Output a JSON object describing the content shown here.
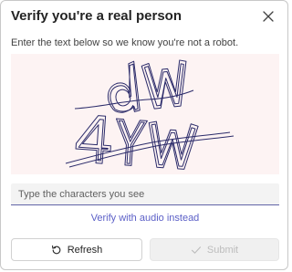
{
  "dialog": {
    "title": "Verify you're a real person",
    "subtitle": "Enter the text below so we know you're not a robot.",
    "close_icon": "close-icon"
  },
  "captcha": {
    "description_icon": "captcha-image",
    "text_line1": "dW",
    "text_line2": "4YW"
  },
  "input": {
    "value": "",
    "placeholder": "Type the characters you see"
  },
  "audio_link": "Verify with audio instead",
  "buttons": {
    "refresh_label": "Refresh",
    "refresh_icon": "refresh-icon",
    "submit_label": "Submit",
    "submit_icon": "checkmark-icon",
    "submit_disabled": true
  },
  "colors": {
    "accent": "#5b5fc7",
    "captcha_bg": "#fdf3f3",
    "captcha_stroke": "#2b2b6a"
  }
}
